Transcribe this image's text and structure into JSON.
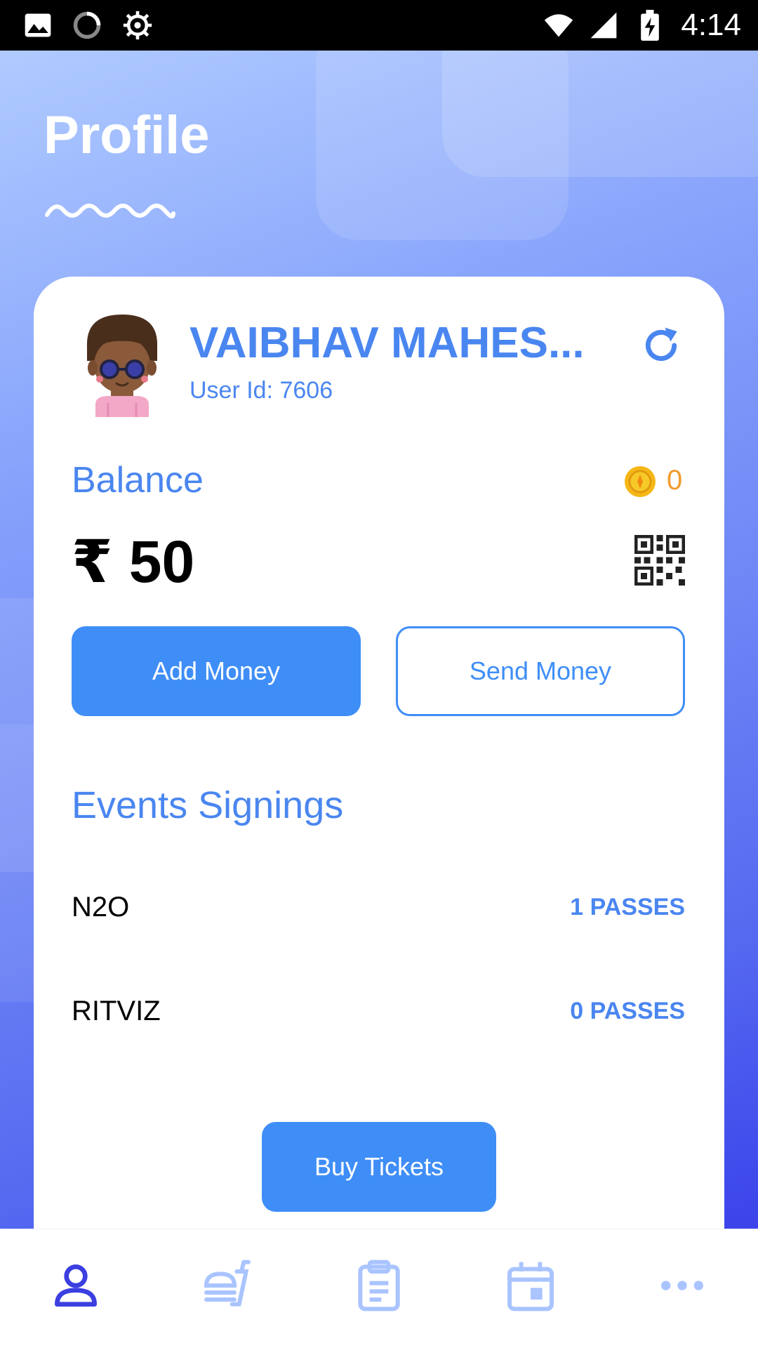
{
  "status_bar": {
    "time": "4:14",
    "icons": [
      "image-icon",
      "loading-icon",
      "usb-debug-icon",
      "wifi-icon",
      "signal-icon",
      "battery-charging-icon"
    ]
  },
  "header": {
    "title": "Profile"
  },
  "profile": {
    "name": "VAIBHAV MAHES...",
    "user_id": "User Id: 7606"
  },
  "balance": {
    "label": "Balance",
    "amount": "₹ 50",
    "coins": "0"
  },
  "actions": {
    "add_money": "Add Money",
    "send_money": "Send Money"
  },
  "events": {
    "title": "Events Signings",
    "items": [
      {
        "name": "N2O",
        "passes": "1 PASSES"
      },
      {
        "name": "RITVIZ",
        "passes": "0 PASSES"
      }
    ]
  },
  "buy_tickets": "Buy Tickets",
  "colors": {
    "accent": "#3f8ef7",
    "text_blue": "#4a86f0",
    "coin": "#f29a2e",
    "nav_active": "#3b3fe0",
    "nav_inactive": "#a9c4ff"
  },
  "bottom_nav": {
    "items": [
      {
        "icon": "profile-icon",
        "active": true
      },
      {
        "icon": "food-icon",
        "active": false
      },
      {
        "icon": "clipboard-icon",
        "active": false
      },
      {
        "icon": "calendar-icon",
        "active": false
      },
      {
        "icon": "more-icon",
        "active": false
      }
    ]
  }
}
